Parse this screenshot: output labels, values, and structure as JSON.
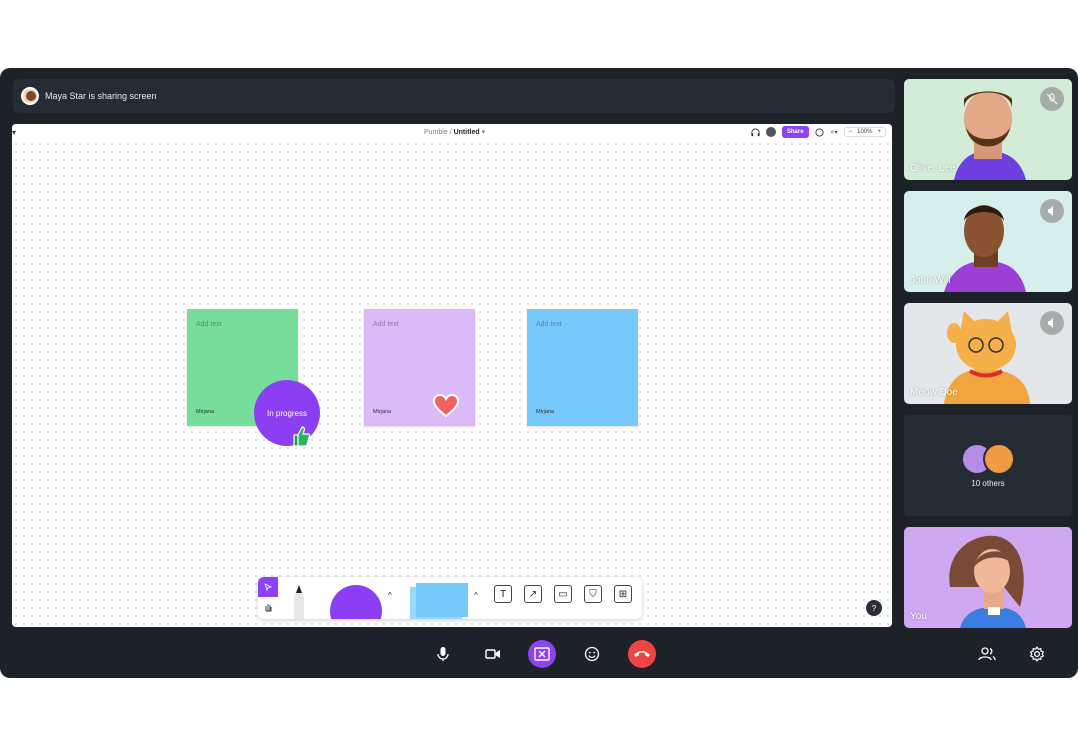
{
  "share_bar": {
    "text": "Maya Star is sharing screen"
  },
  "board": {
    "breadcrumb_workspace": "Pumble",
    "breadcrumb_separator": "/",
    "breadcrumb_file": "Untitled",
    "share_label": "Share",
    "zoom": "100%",
    "help": "?"
  },
  "notes": [
    {
      "placeholder": "Add text",
      "author": "Mirjana",
      "color": "#76dd9b"
    },
    {
      "placeholder": "Add text",
      "author": "Mirjana",
      "color": "#dbbaf8"
    },
    {
      "placeholder": "Add text",
      "author": "Mirjana",
      "color": "#75c9fb"
    }
  ],
  "progress_sticker": {
    "label": "In progress"
  },
  "participants": [
    {
      "name": "Oliver Lee",
      "status": "muted"
    },
    {
      "name": "John Will",
      "status": "speaking"
    },
    {
      "name": "Meow Doe",
      "status": "speaking"
    }
  ],
  "others": {
    "label": "10 others"
  },
  "self_tile": {
    "name": "You"
  },
  "icons": [
    "mic-icon",
    "camera-icon",
    "stop-share-icon",
    "emoji-icon",
    "hangup-icon",
    "people-icon",
    "settings-icon"
  ],
  "colors": {
    "accent": "#8b43f5",
    "hangup": "#ef4444",
    "panel": "#1c2228"
  }
}
